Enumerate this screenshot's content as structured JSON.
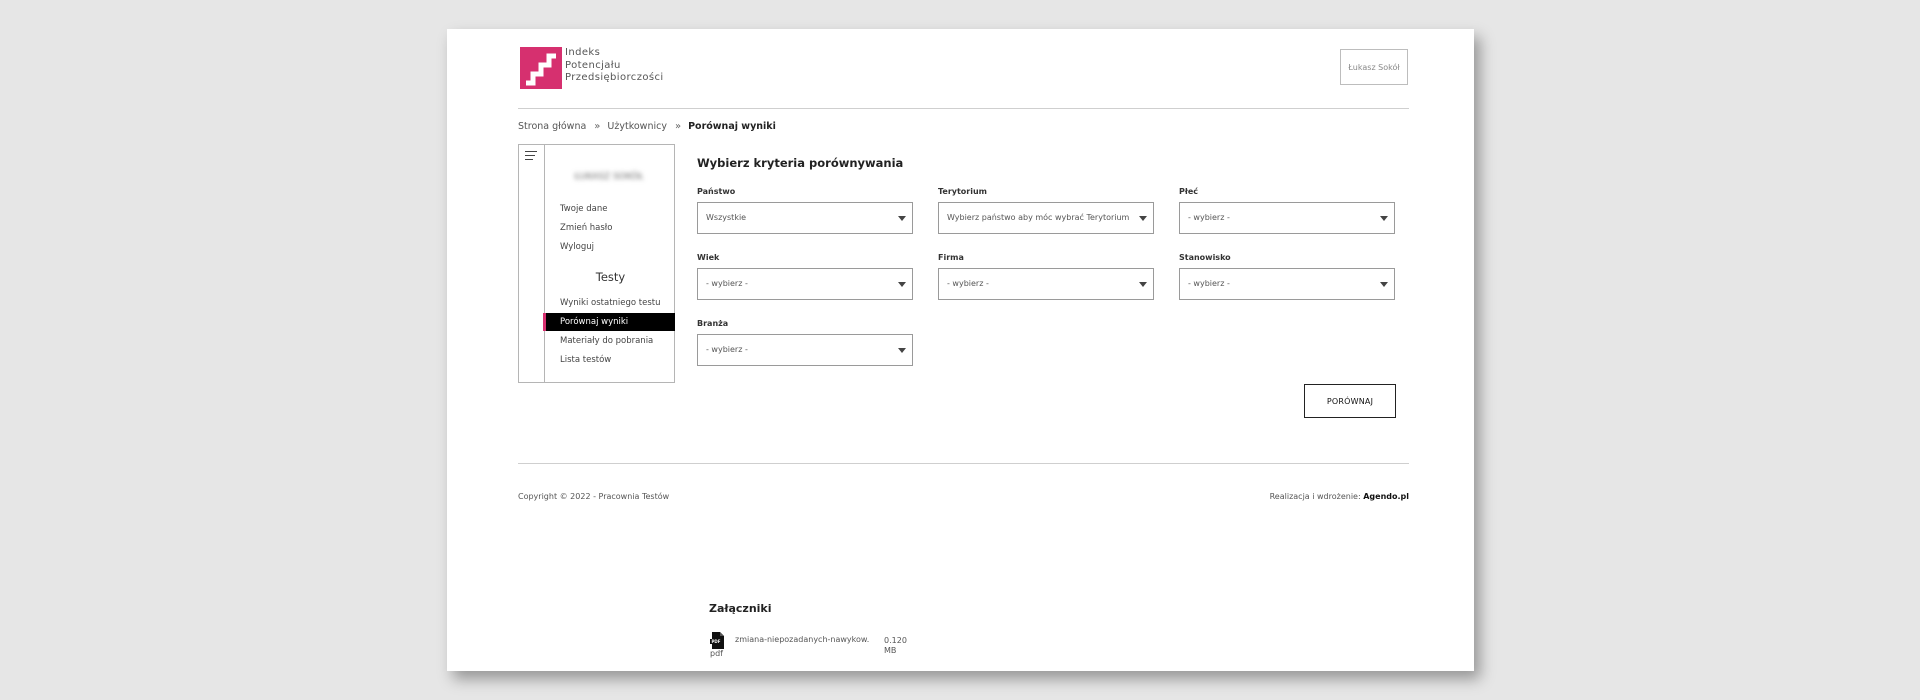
{
  "brand": {
    "logo_lines": [
      "Indeks",
      "Potencjału",
      "Przedsiębiorczości"
    ],
    "accent_color": "#d6306f"
  },
  "header": {
    "user_button": "Łukasz Sokół"
  },
  "breadcrumb": {
    "items": [
      "Strona główna",
      "Użytkownicy",
      "Porównaj wyniki"
    ],
    "separator": "»"
  },
  "sidebar": {
    "user_name": "ŁUKASZ SOKÓŁ",
    "account_links": [
      "Twoje dane",
      "Zmień hasło",
      "Wyloguj"
    ],
    "tests_heading": "Testy",
    "test_links": [
      "Wyniki ostatniego testu",
      "Porównaj wyniki",
      "Materiały do pobrania",
      "Lista testów"
    ],
    "active_item": "Porównaj wyniki"
  },
  "form": {
    "title": "Wybierz kryteria porównywania",
    "fields": [
      {
        "label": "Państwo",
        "value": "Wszystkie"
      },
      {
        "label": "Terytorium",
        "value": "Wybierz państwo aby móc wybrać Terytorium"
      },
      {
        "label": "Płeć",
        "value": "- wybierz -"
      },
      {
        "label": "Wiek",
        "value": "- wybierz -"
      },
      {
        "label": "Firma",
        "value": "- wybierz -"
      },
      {
        "label": "Stanowisko",
        "value": "- wybierz -"
      },
      {
        "label": "Branża",
        "value": "- wybierz -"
      }
    ],
    "submit_label": "PORÓWNAJ"
  },
  "footer": {
    "copyright": "Copyright © 2022 - Pracownia Testów",
    "credits_prefix": "Realizacja i wdrożenie: ",
    "credits_link": "Agendo.pl"
  },
  "attachments": {
    "title": "Załączniki",
    "items": [
      {
        "name": "zmiana-niepozadanych-nawykow.",
        "ext": "pdf",
        "size_value": "0.120",
        "size_unit": "MB"
      }
    ]
  }
}
